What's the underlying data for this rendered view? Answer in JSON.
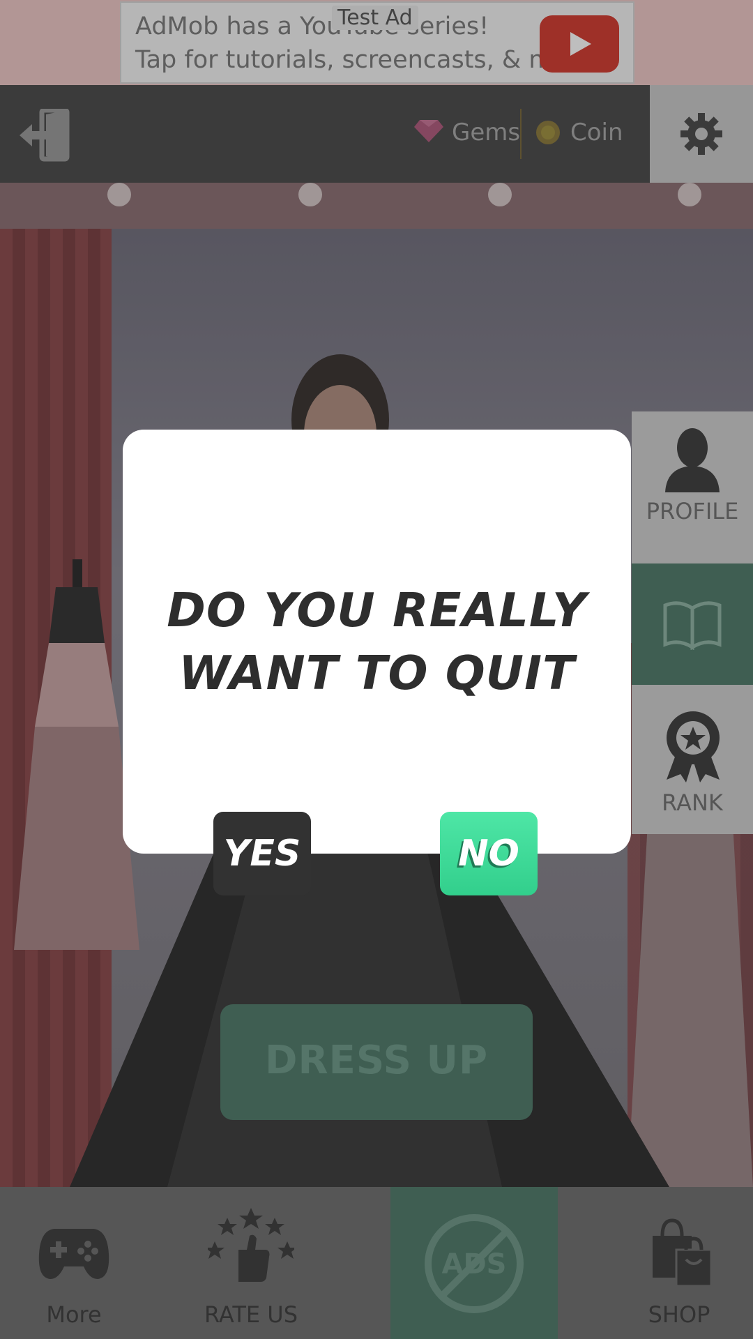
{
  "ad": {
    "line1": "AdMob has a YouTube series!",
    "line2": "Tap for tutorials, screencasts, & more.",
    "badge": "Test Ad"
  },
  "topbar": {
    "gems_label": "Gems",
    "coin_label": "Coin"
  },
  "side_menu": {
    "profile": "PROFILE",
    "rank": "RANK"
  },
  "main": {
    "dress_up": "DRESS UP"
  },
  "bottom_nav": {
    "more": "More",
    "rate_us": "RATE US",
    "shop": "SHOP",
    "no_ads_icon_text": "ADS"
  },
  "dialog": {
    "line1": "DO YOU REALLY",
    "line2": "WANT TO QUIT",
    "yes": "YES",
    "no": "NO"
  },
  "colors": {
    "no_button": "#3ad896",
    "yes_button": "#323232",
    "dialog_bg": "#ffffff"
  }
}
